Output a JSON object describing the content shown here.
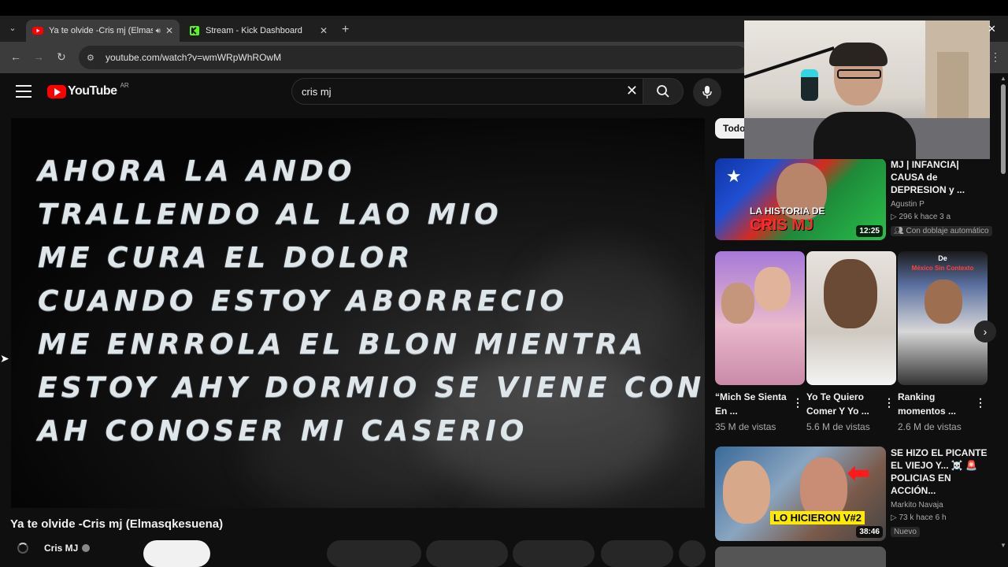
{
  "browser": {
    "tabs": [
      {
        "title": "Ya te olvide -Cris mj (Elmasqkesuena)",
        "active": true
      },
      {
        "title": "Stream - Kick Dashboard",
        "active": false
      }
    ],
    "url": "youtube.com/watch?v=wmWRpWhROwM"
  },
  "youtube": {
    "logo": "YouTube",
    "country": "AR",
    "search_value": "cris mj",
    "filter_chip": "Todo"
  },
  "player": {
    "lyrics": [
      "AHORA LA ANDO",
      "TRALLENDO AL LAO MIO",
      "ME CURA EL DOLOR",
      "CUANDO ESTOY ABORRECIO",
      "ME ENRROLA EL BLON MIENTRA",
      "ESTOY AHY DORMIO SE VIENE CONMIGO",
      "AH CONOSER MI CASERIO"
    ]
  },
  "video": {
    "title": "Ya te olvide -Cris mj (Elmasqkesuena)",
    "channel": "Cris MJ"
  },
  "recommendations": [
    {
      "title": "MJ | INFANCIA| CAUSA de DEPRESION y ...",
      "channel": "Agustin P",
      "stats": "▷ 296 k  hace 3 a",
      "badge": "Con doblaje automático",
      "duration": "12:25",
      "thumb_caption_1": "LA HISTORIA DE",
      "thumb_caption_2": "CRIS MJ"
    },
    {
      "title": "SE HIZO EL PICANTE EL VIEJO Y... ☠️ 🚨 POLICIAS EN ACCIÓN...",
      "channel": "Markito Navaja",
      "stats": "▷ 73 k  hace 6 h",
      "badge": "Nuevo",
      "duration": "38:46",
      "thumb_caption": "LO HICIERON V#2"
    }
  ],
  "shorts": [
    {
      "title": "“Mich Se Sienta En ...",
      "views": "35 M de vistas"
    },
    {
      "title": "Yo Te Quiero Comer Y Yo ...",
      "views": "5.6 M de vistas"
    },
    {
      "title": "Ranking momentos ...",
      "views": "2.6 M de vistas",
      "overlay_top": "De",
      "overlay_sub": "México Sin Contexto"
    }
  ]
}
